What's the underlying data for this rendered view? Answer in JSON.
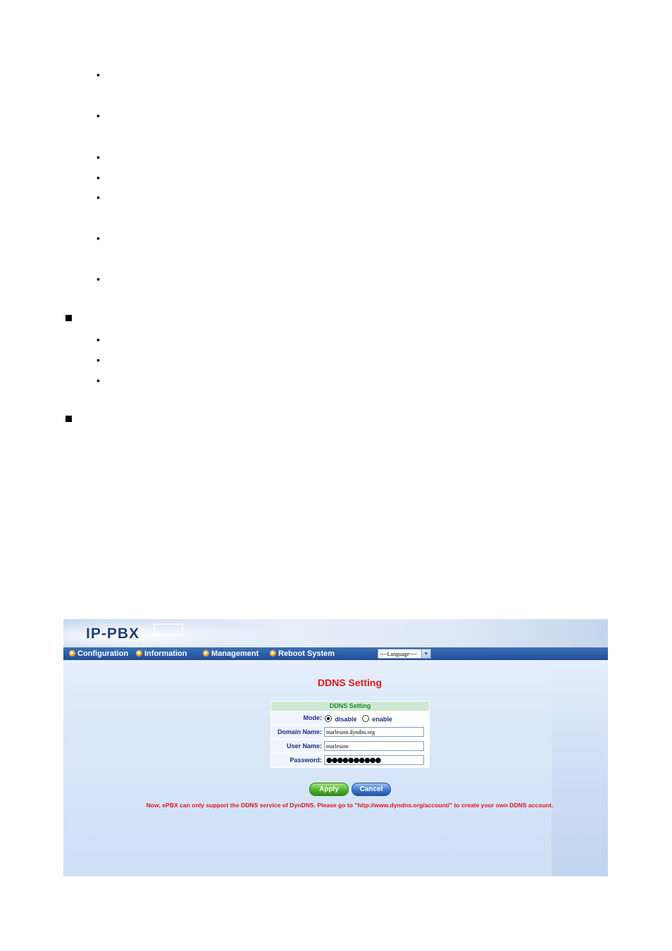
{
  "doc": {
    "bullet_glyph": "•",
    "square_glyph": "■"
  },
  "app": {
    "logo": "IP-PBX",
    "nav": [
      {
        "label": "Configuration"
      },
      {
        "label": "Information"
      },
      {
        "label": "Management"
      },
      {
        "label": "Reboot System"
      }
    ],
    "language_select": {
      "value": "----Language----"
    }
  },
  "main": {
    "title": "DDNS Setting",
    "form": {
      "header": "DDNS Setting",
      "mode_label": "Mode:",
      "mode_options": [
        {
          "label": "disable",
          "selected": true
        },
        {
          "label": "enable",
          "selected": false
        }
      ],
      "domain_label": "Domain Name:",
      "domain_value": "marlesion.dyndns.org",
      "user_label": "User Name:",
      "user_value": "marlesion",
      "password_label": "Password:",
      "password_value": "●●●●●●●●●●"
    },
    "apply_label": "Apply",
    "cancel_label": "Cancel",
    "notice": "Now, ePBX can only support the DDNS service of DynDNS. Please go to \"http://www.dyndns.org/account/\" to create your own DDNS account."
  },
  "colors": {
    "title_red": "#e1141c",
    "nav_blue": "#1e4f98",
    "form_header_green": "#1f8a2f"
  }
}
